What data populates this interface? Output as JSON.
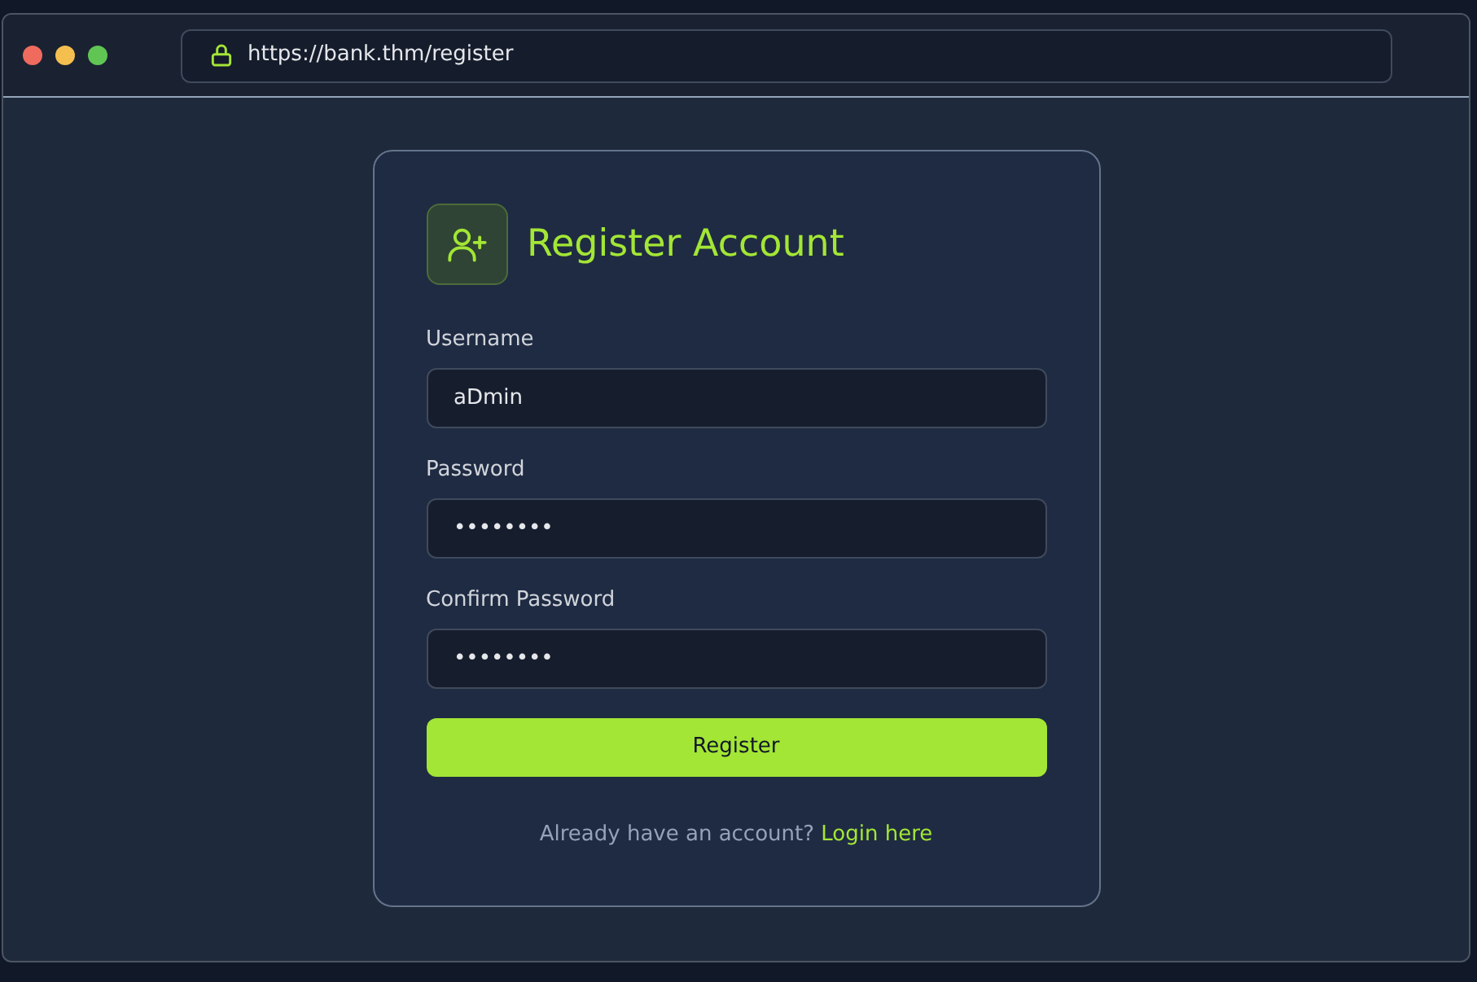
{
  "browser": {
    "url": "https://bank.thm/register"
  },
  "form": {
    "title": "Register Account",
    "fields": [
      {
        "label": "Username",
        "value": "aDmin"
      },
      {
        "label": "Password",
        "value": "••••••••"
      },
      {
        "label": "Confirm Password",
        "value": "••••••••"
      }
    ],
    "submit": "Register",
    "footer": {
      "text": "Already have an account?",
      "link": "Login here"
    }
  }
}
